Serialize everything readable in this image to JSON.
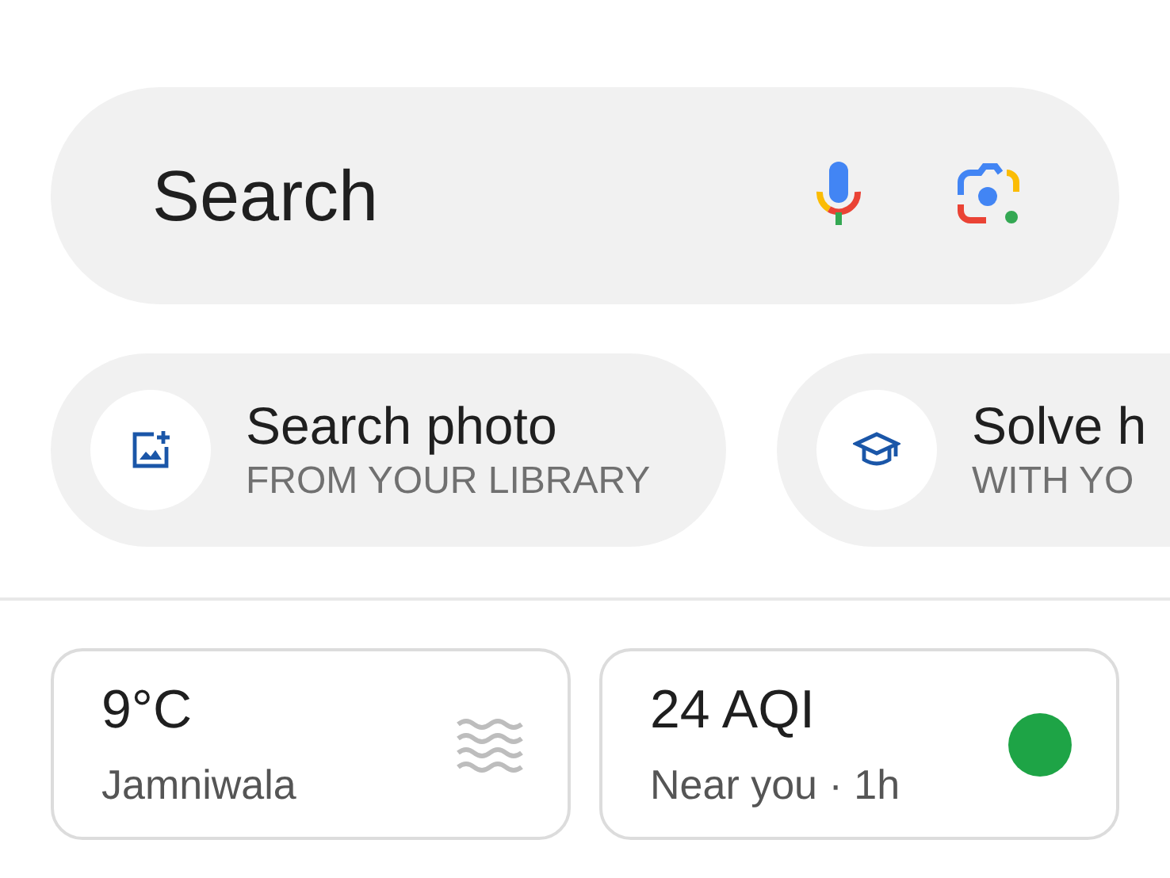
{
  "search": {
    "placeholder": "Search"
  },
  "chips": [
    {
      "kind": "photo",
      "title": "Search photo",
      "subtitle": "FROM YOUR LIBRARY"
    },
    {
      "kind": "homework",
      "title": "Solve h",
      "subtitle": "WITH YO"
    }
  ],
  "cards": [
    {
      "kind": "weather",
      "title": "9°C",
      "subtitle": "Jamniwala"
    },
    {
      "kind": "aqi",
      "title": "24 AQI",
      "subtitle": "Near you · 1h",
      "color": "#1ea446"
    }
  ]
}
